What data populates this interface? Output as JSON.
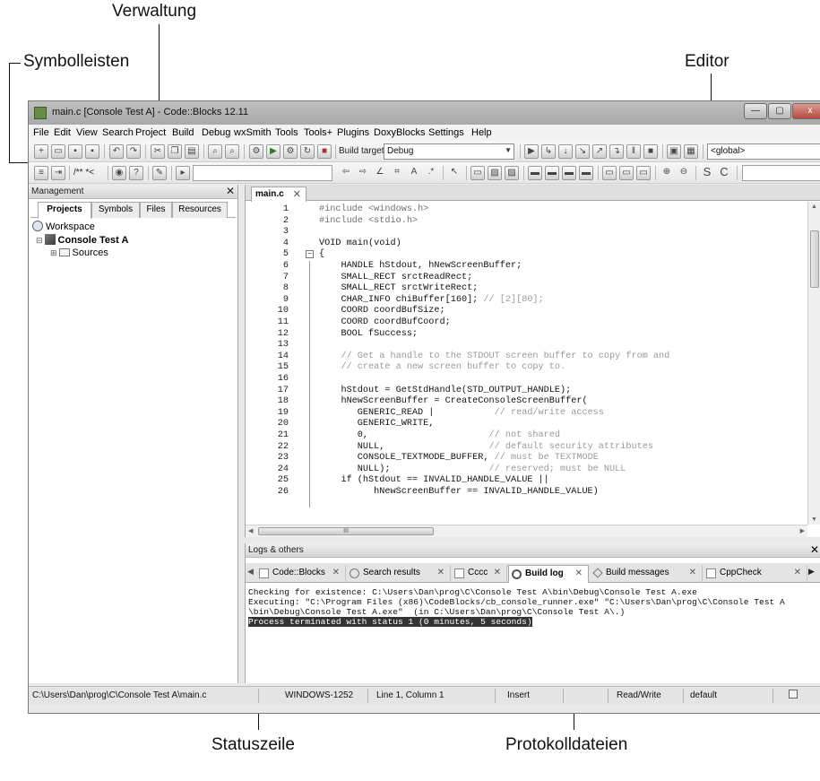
{
  "callouts": {
    "verwaltung": "Verwaltung",
    "symbolleisten": "Symbolleisten",
    "editor": "Editor",
    "statuszeile": "Statuszeile",
    "protokolldateien": "Protokolldateien"
  },
  "window": {
    "title": "main.c [Console Test A] - Code::Blocks 12.11",
    "buttons": {
      "minimize": "—",
      "maximize": "▢",
      "close": "x"
    }
  },
  "menu": [
    "File",
    "Edit",
    "View",
    "Search",
    "Project",
    "Build",
    "Debug",
    "wxSmith",
    "Tools",
    "Tools+",
    "Plugins",
    "DoxyBlocks",
    "Settings",
    "Help"
  ],
  "toolbar": {
    "build_target_label": "Build target:",
    "build_target_value": "Debug",
    "scope_value": "<global>",
    "doxy_label": "/** *<"
  },
  "management": {
    "title": "Management",
    "close": "✕",
    "tabs": [
      "Projects",
      "Symbols",
      "Files",
      "Resources"
    ],
    "active_tab": "Projects",
    "tree": {
      "workspace": "Workspace",
      "project": "Console Test A",
      "folder": "Sources"
    }
  },
  "editor": {
    "tab_label": "main.c",
    "tab_close": "✕",
    "hscroll_grip": "III",
    "lines": [
      {
        "n": "1",
        "t": "#include <windows.h>",
        "k": "pre"
      },
      {
        "n": "2",
        "t": "#include <stdio.h>",
        "k": "pre"
      },
      {
        "n": "3",
        "t": "",
        "k": ""
      },
      {
        "n": "4",
        "t": "VOID main(void)",
        "k": ""
      },
      {
        "n": "5",
        "t": "{",
        "k": ""
      },
      {
        "n": "6",
        "t": "    HANDLE hStdout, hNewScreenBuffer;",
        "k": ""
      },
      {
        "n": "7",
        "t": "    SMALL_RECT srctReadRect;",
        "k": ""
      },
      {
        "n": "8",
        "t": "    SMALL_RECT srctWriteRect;",
        "k": ""
      },
      {
        "n": "9",
        "t": "    CHAR_INFO chiBuffer[160];",
        "c": " // [2][80];",
        "k": ""
      },
      {
        "n": "10",
        "t": "    COORD coordBufSize;",
        "k": ""
      },
      {
        "n": "11",
        "t": "    COORD coordBufCoord;",
        "k": ""
      },
      {
        "n": "12",
        "t": "    BOOL fSuccess;",
        "k": ""
      },
      {
        "n": "13",
        "t": "",
        "k": ""
      },
      {
        "n": "14",
        "t": "",
        "c": "    // Get a handle to the STDOUT screen buffer to copy from and",
        "k": ""
      },
      {
        "n": "15",
        "t": "",
        "c": "    // create a new screen buffer to copy to.",
        "k": ""
      },
      {
        "n": "16",
        "t": "",
        "k": ""
      },
      {
        "n": "17",
        "t": "    hStdout = GetStdHandle(STD_OUTPUT_HANDLE);",
        "k": ""
      },
      {
        "n": "18",
        "t": "    hNewScreenBuffer = CreateConsoleScreenBuffer(",
        "k": ""
      },
      {
        "n": "19",
        "t": "       GENERIC_READ |",
        "c": "           // read/write access",
        "k": ""
      },
      {
        "n": "20",
        "t": "       GENERIC_WRITE,",
        "k": ""
      },
      {
        "n": "21",
        "t": "       0,",
        "c": "                      // not shared",
        "k": ""
      },
      {
        "n": "22",
        "t": "       NULL,",
        "c": "                   // default security attributes",
        "k": ""
      },
      {
        "n": "23",
        "t": "       CONSOLE_TEXTMODE_BUFFER,",
        "c": " // must be TEXTMODE",
        "k": ""
      },
      {
        "n": "24",
        "t": "       NULL);",
        "c": "                  // reserved; must be NULL",
        "k": ""
      },
      {
        "n": "25",
        "t": "    if (hStdout == INVALID_HANDLE_VALUE ||",
        "k": ""
      },
      {
        "n": "26",
        "t": "          hNewScreenBuffer == INVALID_HANDLE_VALUE)",
        "k": ""
      }
    ]
  },
  "logs": {
    "title": "Logs & others",
    "close": "✕",
    "tabs": [
      "Code::Blocks",
      "Search results",
      "Cccc",
      "Build log",
      "Build messages",
      "CppCheck"
    ],
    "active_tab": "Build log",
    "lines": [
      "Checking for existence: C:\\Users\\Dan\\prog\\C\\Console Test A\\bin\\Debug\\Console Test A.exe",
      "Executing: \"C:\\Program Files (x86)\\CodeBlocks/cb_console_runner.exe\" \"C:\\Users\\Dan\\prog\\C\\Console Test A",
      "\\bin\\Debug\\Console Test A.exe\"  (in C:\\Users\\Dan\\prog\\C\\Console Test A\\.)",
      "Process terminated with status 1 (0 minutes, 5 seconds)"
    ]
  },
  "status": {
    "path": "C:\\Users\\Dan\\prog\\C\\Console Test A\\main.c",
    "encoding": "WINDOWS-1252",
    "position": "Line 1, Column 1",
    "mode": "Insert",
    "access": "Read/Write",
    "profile": "default"
  }
}
